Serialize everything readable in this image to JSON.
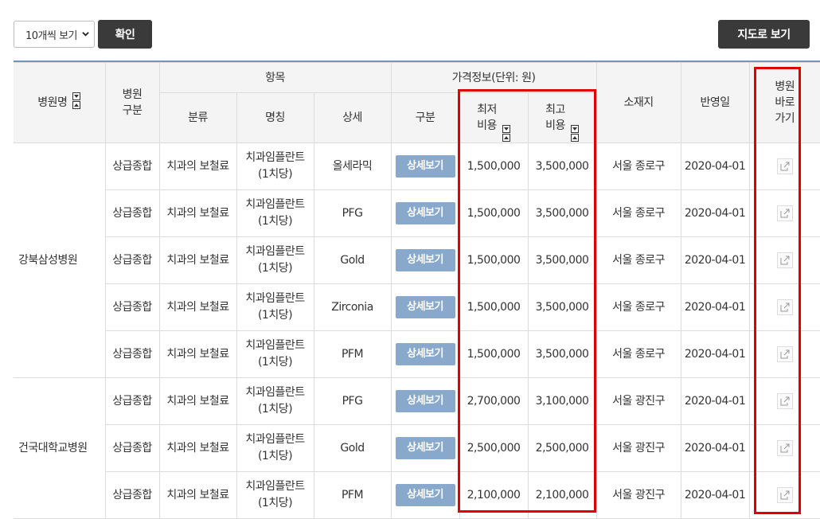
{
  "toolbar": {
    "page_select_value": "10개씩 보기",
    "confirm_label": "확인",
    "map_label": "지도로 보기"
  },
  "table": {
    "headers": {
      "hospital_name": "병원명",
      "hospital_type": "병원\n구분",
      "item_group": "항목",
      "category": "분류",
      "name": "명칭",
      "detail": "상세",
      "price_group": "가격정보(단위: 원)",
      "division": "구분",
      "min_cost": "최저\n비용",
      "max_cost": "최고\n비용",
      "location": "소재지",
      "reflect_date": "반영일",
      "go_hospital": "병원\n바로\n가기"
    },
    "detail_button_label": "상세보기",
    "groups": [
      {
        "hospital": "강북삼성병원",
        "rows": [
          {
            "type": "상급종합",
            "category": "치과의 보철료",
            "name": "치과임플란트\n(1치당)",
            "detail": "올세라믹",
            "min": "1,500,000",
            "max": "3,500,000",
            "location": "서울 종로구",
            "date": "2020-04-01"
          },
          {
            "type": "상급종합",
            "category": "치과의 보철료",
            "name": "치과임플란트\n(1치당)",
            "detail": "PFG",
            "min": "1,500,000",
            "max": "3,500,000",
            "location": "서울 종로구",
            "date": "2020-04-01"
          },
          {
            "type": "상급종합",
            "category": "치과의 보철료",
            "name": "치과임플란트\n(1치당)",
            "detail": "Gold",
            "min": "1,500,000",
            "max": "3,500,000",
            "location": "서울 종로구",
            "date": "2020-04-01"
          },
          {
            "type": "상급종합",
            "category": "치과의 보철료",
            "name": "치과임플란트\n(1치당)",
            "detail": "Zirconia",
            "min": "1,500,000",
            "max": "3,500,000",
            "location": "서울 종로구",
            "date": "2020-04-01"
          },
          {
            "type": "상급종합",
            "category": "치과의 보철료",
            "name": "치과임플란트\n(1치당)",
            "detail": "PFM",
            "min": "1,500,000",
            "max": "3,500,000",
            "location": "서울 종로구",
            "date": "2020-04-01"
          }
        ]
      },
      {
        "hospital": "건국대학교병원",
        "rows": [
          {
            "type": "상급종합",
            "category": "치과의 보철료",
            "name": "치과임플란트\n(1치당)",
            "detail": "PFG",
            "min": "2,700,000",
            "max": "3,100,000",
            "location": "서울 광진구",
            "date": "2020-04-01"
          },
          {
            "type": "상급종합",
            "category": "치과의 보철료",
            "name": "치과임플란트\n(1치당)",
            "detail": "Gold",
            "min": "2,500,000",
            "max": "2,500,000",
            "location": "서울 광진구",
            "date": "2020-04-01"
          },
          {
            "type": "상급종합",
            "category": "치과의 보철료",
            "name": "치과임플란트\n(1치당)",
            "detail": "PFM",
            "min": "2,100,000",
            "max": "2,100,000",
            "location": "서울 광진구",
            "date": "2020-04-01"
          }
        ]
      }
    ]
  },
  "colors": {
    "header_border": "#7294c4",
    "detail_button": "#88a9cc",
    "highlight": "#e00000",
    "dark_button": "#3a3a3a"
  }
}
